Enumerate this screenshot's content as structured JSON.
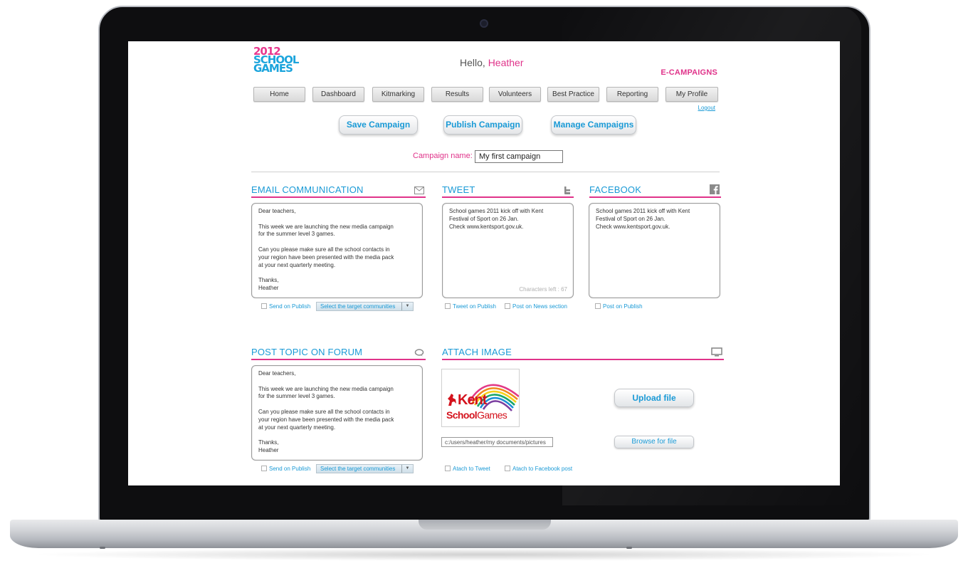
{
  "header": {
    "logo_line1": "2012",
    "logo_line2": "SCHOOL",
    "logo_line3": "GAMES",
    "greeting": "Hello,",
    "user_name": "Heather",
    "section": "E-CAMPAIGNS",
    "logout": "Logout"
  },
  "nav": [
    {
      "label": "Home"
    },
    {
      "label": "Dashboard"
    },
    {
      "label": "Kitmarking"
    },
    {
      "label": "Results"
    },
    {
      "label": "Volunteers"
    },
    {
      "label": "Best Practice"
    },
    {
      "label": "Reporting"
    },
    {
      "label": "My Profile"
    }
  ],
  "actions": {
    "save": "Save Campaign",
    "publish": "Publish Campaign",
    "manage": "Manage Campaigns"
  },
  "campaign": {
    "label": "Campaign name:",
    "value": "My first campaign"
  },
  "email": {
    "title": "EMAIL COMMUNICATION",
    "icon": "envelope-icon",
    "body": "Dear teachers,\n\nThis week we are launching the new media campaign\nfor the summer level 3 games.\n\nCan you please make sure all the school contacts in\nyour region have been presented with the media pack\nat your next quarterly meeting.\n\nThanks,\nHeather",
    "send_on_publish": "Send on Publish",
    "target": "Select the target communities"
  },
  "tweet": {
    "title": "TWEET",
    "icon": "twitter-icon",
    "body": "School games 2011 kick off with Kent\nFestival of Sport on 26 Jan.\nCheck www.kentsport.gov.uk.",
    "chars_left": "Characters left : 67",
    "tweet_on_publish": "Tweet on Publish",
    "post_news": "Post on News section"
  },
  "facebook": {
    "title": "FACEBOOK",
    "icon": "facebook-icon",
    "body": "School games 2011 kick off with Kent\nFestival of Sport on 26 Jan.\nCheck www.kentsport.gov.uk.",
    "post_on_publish": "Post on Publish"
  },
  "forum": {
    "title": "POST TOPIC ON FORUM",
    "icon": "speech-bubble-icon",
    "body": "Dear teachers,\n\nThis week we are launching the new media campaign\nfor the summer level 3 games.\n\nCan you please make sure all the school contacts in\nyour region have been presented with the media pack\nat your next quarterly meeting.\n\nThanks,\nHeather",
    "send_on_publish": "Send on Publish",
    "target": "Select the target communities"
  },
  "image": {
    "title": "ATTACH IMAGE",
    "icon": "monitor-icon",
    "logo_kent": "Kent",
    "logo_school": "School",
    "logo_games": "Games",
    "path": "c:/users/heather/my documents/pictures",
    "upload": "Upload file",
    "browse": "Browse for file",
    "attach_tweet": "Atach to Tweet",
    "attach_fb": "Atach to Facebook post"
  },
  "colors": {
    "accent_pink": "#e0338a",
    "accent_blue": "#1a9ad6"
  }
}
